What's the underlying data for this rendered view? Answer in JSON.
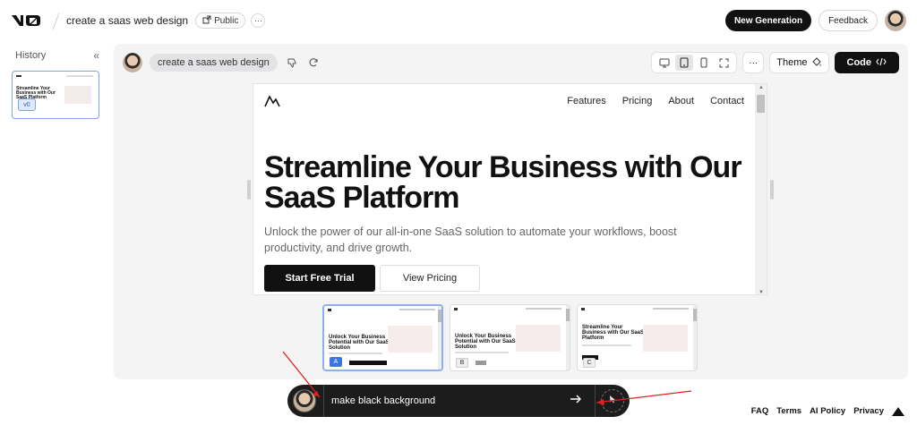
{
  "header": {
    "project_title": "create a saas web design",
    "visibility_label": "Public",
    "more_label": "···",
    "new_generation_label": "New Generation",
    "feedback_label": "Feedback"
  },
  "sidebar": {
    "title": "History",
    "collapse_label": "«",
    "items": [
      {
        "title": "Streamline Your Business with Our SaaS Platform",
        "version": "v0"
      }
    ]
  },
  "main": {
    "prompt_text": "create a saas web design",
    "toolbar": {
      "more_label": "···",
      "theme_label": "Theme",
      "code_label": "Code"
    },
    "preview": {
      "nav_links": [
        "Features",
        "Pricing",
        "About",
        "Contact"
      ],
      "hero_title": "Streamline Your Business with Our SaaS Platform",
      "hero_subtitle": "Unlock the power of our all-in-one SaaS solution to automate your workflows, boost productivity, and drive growth.",
      "primary_button": "Start Free Trial",
      "secondary_button": "View Pricing"
    },
    "variants": [
      {
        "title": "Unlock Your Business Potential with Our SaaS Solution",
        "badge": "A",
        "selected": true
      },
      {
        "title": "Unlock Your Business Potential with Our SaaS Solution",
        "badge": "B",
        "selected": false
      },
      {
        "title": "Streamline Your Business with Our SaaS Platform",
        "badge": "C",
        "selected": false
      }
    ]
  },
  "chat": {
    "input_value": "make black background"
  },
  "footer": {
    "links": [
      "FAQ",
      "Terms",
      "AI Policy",
      "Privacy"
    ]
  },
  "colors": {
    "accent_blue": "#3b74e6",
    "annotation_red": "#e02020",
    "dark": "#111111"
  }
}
